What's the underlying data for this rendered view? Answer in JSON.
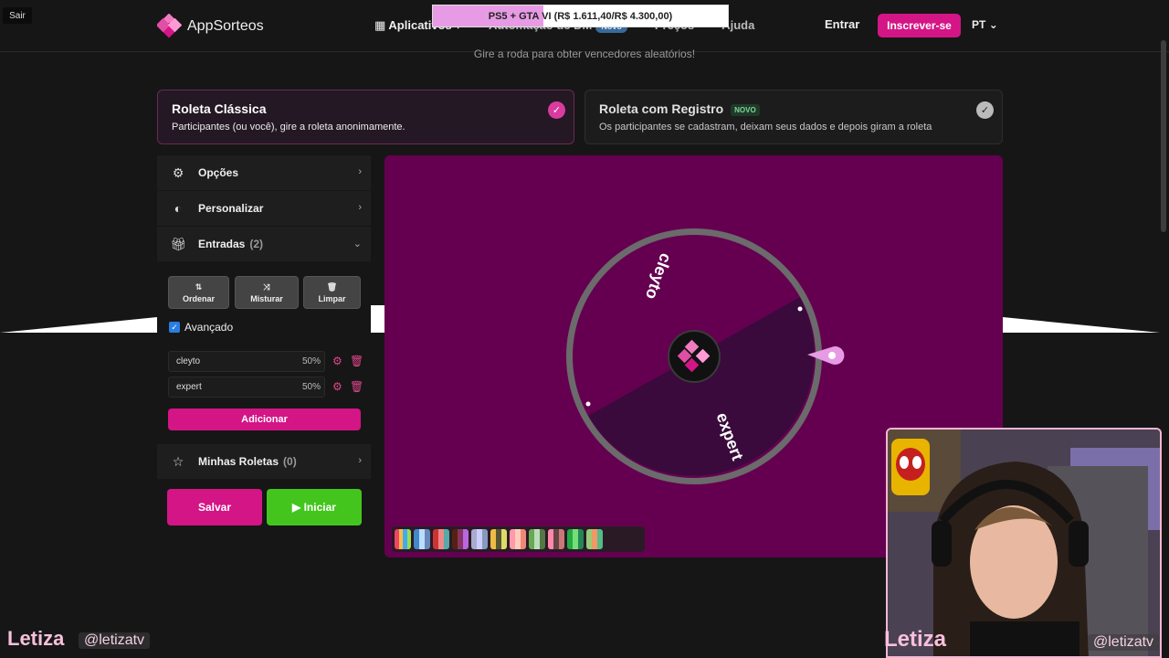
{
  "nav": {
    "brand": "AppSorteos",
    "menu": [
      "Aplicativos",
      "Automação de DM",
      "Preços",
      "Ajuda"
    ],
    "menu_badge": "Novo",
    "entrar": "Entrar",
    "inscrever": "Inscrever-se",
    "lang": "PT"
  },
  "overlay": {
    "sair": "Sair",
    "progress_text": "PS5 + GTA VI (R$ 1.611,40/R$ 4.300,00)",
    "progress_fraction": 0.375,
    "streamer": "Letiza",
    "handle": "@letizatv"
  },
  "subtitle": "Gire a roda para obter vencedores aleatórios!",
  "modes": [
    {
      "title": "Roleta Clássica",
      "desc": "Participantes (ou você), gire a roleta anonimamente.",
      "selected": true
    },
    {
      "title": "Roleta com Registro",
      "badge": "NOVO",
      "desc": "Os participantes se cadastram, deixam seus dados e depois giram a roleta",
      "selected": false
    }
  ],
  "sidebar": {
    "opcoes": "Opções",
    "personalizar": "Personalizar",
    "entradas": "Entradas",
    "entradas_count": "(2)",
    "tools": [
      "Ordenar",
      "Misturar",
      "Limpar"
    ],
    "advanced": "Avançado",
    "entries": [
      {
        "name": "cleyto",
        "pct": "50%"
      },
      {
        "name": "expert",
        "pct": "50%"
      }
    ],
    "add": "Adicionar",
    "minhas": "Minhas Roletas",
    "minhas_count": "(0)",
    "salvar": "Salvar",
    "iniciar": "Iniciar"
  },
  "wheel": {
    "segments": [
      {
        "label": "cleyto",
        "color": "#650051"
      },
      {
        "label": "expert",
        "color": "#3a0a3c"
      }
    ],
    "rim_color": "#6b6b6b",
    "accent": "#e79be4"
  },
  "colors": {
    "brand": "#d41586",
    "start": "#43c51e",
    "background": "#161616"
  }
}
